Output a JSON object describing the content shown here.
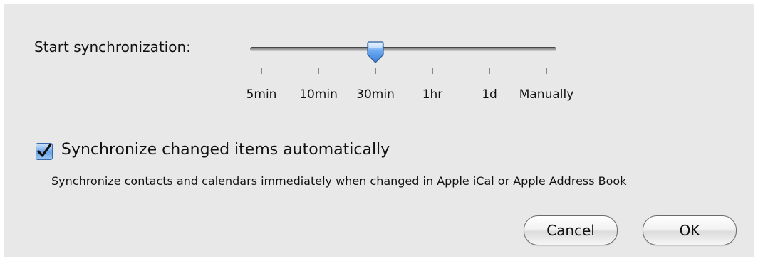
{
  "sync": {
    "start_label": "Start synchronization:",
    "slider": {
      "options": [
        "5min",
        "10min",
        "30min",
        "1hr",
        "1d",
        "Manually"
      ],
      "selected": "30min",
      "selected_index": 2
    },
    "auto": {
      "label": "Synchronize changed items automatically",
      "checked": true,
      "description": "Synchronize contacts and calendars immediately when changed in Apple iCal or Apple Address Book"
    }
  },
  "buttons": {
    "cancel": "Cancel",
    "ok": "OK"
  },
  "colors": {
    "panel_background": "#e8e8e8",
    "accent_blue": "#6aa3e6"
  }
}
